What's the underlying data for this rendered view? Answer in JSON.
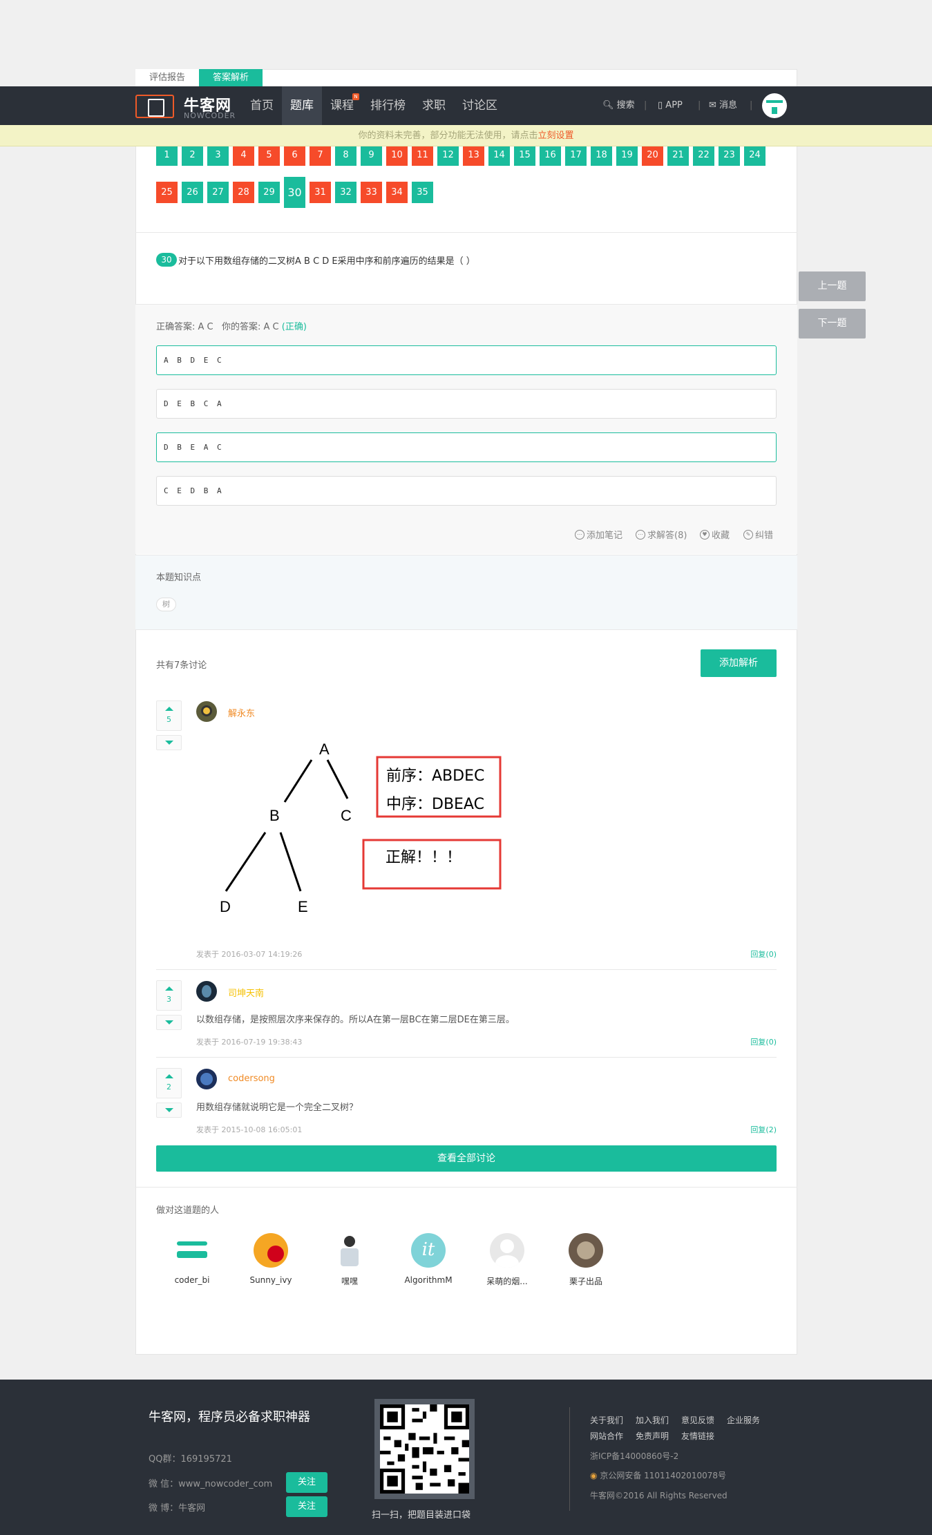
{
  "tabs": [
    "评估报告",
    "答案解析"
  ],
  "nav": {
    "logo_cn": "牛客网",
    "logo_en": "NOWCODER",
    "items": [
      "首页",
      "题库",
      "课程",
      "排行榜",
      "求职",
      "讨论区"
    ],
    "course_badge": "N",
    "search": "搜索",
    "app": "APP",
    "msg": "消息"
  },
  "notice": {
    "text": "你的资料未完善，部分功能无法使用，请点击",
    "link": "立刻设置"
  },
  "question_numbers": [
    {
      "n": "1",
      "s": "g"
    },
    {
      "n": "2",
      "s": "g"
    },
    {
      "n": "3",
      "s": "g"
    },
    {
      "n": "4",
      "s": "r"
    },
    {
      "n": "5",
      "s": "r"
    },
    {
      "n": "6",
      "s": "r"
    },
    {
      "n": "7",
      "s": "r"
    },
    {
      "n": "8",
      "s": "g"
    },
    {
      "n": "9",
      "s": "g"
    },
    {
      "n": "10",
      "s": "r"
    },
    {
      "n": "11",
      "s": "r"
    },
    {
      "n": "12",
      "s": "g"
    },
    {
      "n": "13",
      "s": "r"
    },
    {
      "n": "14",
      "s": "g"
    },
    {
      "n": "15",
      "s": "g"
    },
    {
      "n": "16",
      "s": "g"
    },
    {
      "n": "17",
      "s": "g"
    },
    {
      "n": "18",
      "s": "g"
    },
    {
      "n": "19",
      "s": "g"
    },
    {
      "n": "20",
      "s": "r"
    },
    {
      "n": "21",
      "s": "g"
    },
    {
      "n": "22",
      "s": "g"
    },
    {
      "n": "23",
      "s": "g"
    },
    {
      "n": "24",
      "s": "g"
    },
    {
      "n": "25",
      "s": "r"
    },
    {
      "n": "26",
      "s": "g"
    },
    {
      "n": "27",
      "s": "g"
    },
    {
      "n": "28",
      "s": "r"
    },
    {
      "n": "29",
      "s": "g"
    },
    {
      "n": "30",
      "s": "cur"
    },
    {
      "n": "31",
      "s": "r"
    },
    {
      "n": "32",
      "s": "g"
    },
    {
      "n": "33",
      "s": "r"
    },
    {
      "n": "34",
      "s": "r"
    },
    {
      "n": "35",
      "s": "g"
    }
  ],
  "question": {
    "num": "30",
    "text": "对于以下用数组存储的二叉树A B C D E采用中序和前序遍历的结果是（ ）"
  },
  "answer": {
    "prefix": "正确答案: A C   你的答案: A C",
    "status": "(正确)"
  },
  "options": [
    "A B D E C",
    "D E B C A",
    "D B E A C",
    "C E D B A"
  ],
  "actions": [
    "添加笔记",
    "求解答(8)",
    "收藏",
    "纠错"
  ],
  "knowledge": {
    "title": "本题知识点",
    "tag": "树"
  },
  "discussion": {
    "count": "共有7条讨论",
    "add_button": "添加解析",
    "comments": [
      {
        "votes": "5",
        "name": "解永东",
        "text": "",
        "date": "发表于 2016-03-07 14:19:26",
        "reply": "回复(0)"
      },
      {
        "votes": "3",
        "name": "司坤天南",
        "text": "以数组存储，是按照层次序来保存的。所以A在第一层BC在第二层DE在第三层。",
        "date": "发表于 2016-07-19 19:38:43",
        "reply": "回复(0)"
      },
      {
        "votes": "2",
        "name": "codersong",
        "text": "用数组存储就说明它是一个完全二叉树？",
        "date": "发表于 2015-10-08 16:05:01",
        "reply": "回复(2)"
      }
    ],
    "view_all": "查看全部讨论"
  },
  "tree_image": {
    "nodes": [
      "A",
      "B",
      "C",
      "D",
      "E"
    ],
    "box1_line1": "前序：ABDEC",
    "box1_line2": "中序：DBEAC",
    "box2": "正解！！！"
  },
  "right_people": {
    "title": "做对这道题的人",
    "people": [
      "coder_bi",
      "Sunny_ivy",
      "嘿嘿",
      "AlgorithmM",
      "呆萌的烟...",
      "栗子出品"
    ]
  },
  "side": {
    "prev": "上一题",
    "next": "下一题"
  },
  "footer": {
    "slogan": "牛客网，程序员必备求职神器",
    "qq": "QQ群：169195721",
    "wechat": "微 信：www_nowcoder_com",
    "weibo": "微 博：牛客网",
    "follow": "关注",
    "qr_caption": "扫一扫，把题目装进口袋",
    "links1": [
      "关于我们",
      "加入我们",
      "意见反馈",
      "企业服务"
    ],
    "links2": [
      "网站合作",
      "免责声明",
      "友情链接"
    ],
    "icp": "浙ICP备14000860号-2",
    "police": "京公网安备 11011402010078号",
    "copyright": "牛客网©2016 All Rights Reserved"
  },
  "colors": {
    "accent": "#1abc9c",
    "wrong": "#f64b2a",
    "nav_bg": "#2b3038"
  }
}
